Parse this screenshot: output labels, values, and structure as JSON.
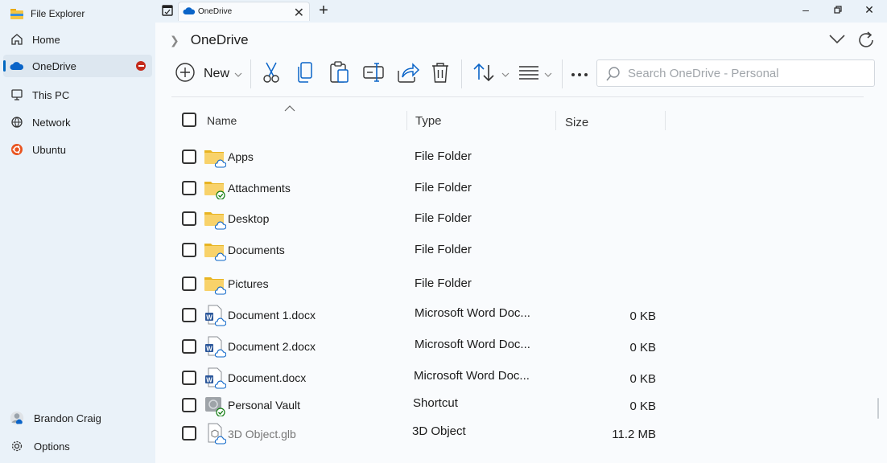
{
  "sidebar": {
    "title": "File Explorer",
    "items": [
      {
        "label": "Home"
      },
      {
        "label": "OneDrive"
      },
      {
        "label": "This PC"
      },
      {
        "label": "Network"
      },
      {
        "label": "Ubuntu"
      }
    ],
    "account": "Brandon Craig",
    "options": "Options"
  },
  "tab": {
    "label": "OneDrive"
  },
  "breadcrumb": {
    "current": "OneDrive"
  },
  "toolbar": {
    "new_label": "New"
  },
  "search": {
    "placeholder": "Search OneDrive - Personal"
  },
  "columns": {
    "name": "Name",
    "type": "Type",
    "size": "Size"
  },
  "files": [
    {
      "name": "Apps",
      "type": "File Folder",
      "size": "",
      "icon": "folder-cloud-icon"
    },
    {
      "name": "Attachments",
      "type": "File Folder",
      "size": "",
      "icon": "folder-synced-icon"
    },
    {
      "name": "Desktop",
      "type": "File Folder",
      "size": "",
      "icon": "folder-cloud-icon"
    },
    {
      "name": "Documents",
      "type": "File Folder",
      "size": "",
      "icon": "folder-cloud-icon"
    },
    {
      "name": "Pictures",
      "type": "File Folder",
      "size": "",
      "icon": "folder-cloud-icon"
    },
    {
      "name": "Document 1.docx",
      "type": "Microsoft Word Doc...",
      "size": "0 KB",
      "icon": "word-doc-cloud-icon"
    },
    {
      "name": "Document 2.docx",
      "type": "Microsoft Word Doc...",
      "size": "0 KB",
      "icon": "word-doc-cloud-icon"
    },
    {
      "name": "Document.docx",
      "type": "Microsoft Word Doc...",
      "size": "0 KB",
      "icon": "word-doc-cloud-icon"
    },
    {
      "name": "Personal Vault",
      "type": "Shortcut",
      "size": "0 KB",
      "icon": "vault-synced-icon"
    },
    {
      "name": "3D Object.glb",
      "type": "3D Object",
      "size": "11.2 MB",
      "icon": "3d-object-cloud-icon"
    }
  ],
  "colors": {
    "accent": "#0067c0",
    "folder": "#f4c542",
    "word": "#2b579a"
  }
}
